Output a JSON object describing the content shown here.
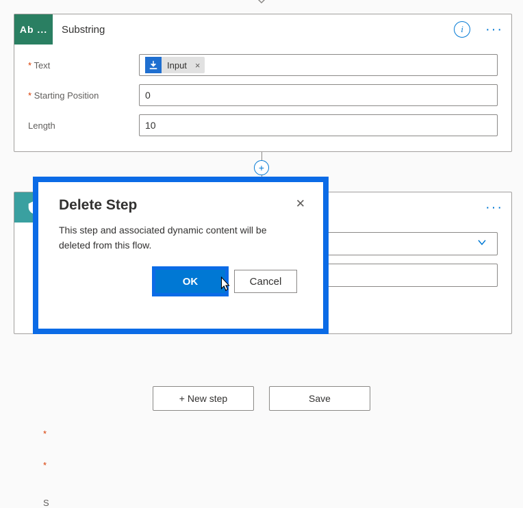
{
  "step1": {
    "iconLabel": "Ab ...",
    "title": "Substring",
    "fields": {
      "textLabel": "Text",
      "textToken": "Input",
      "startLabel": "Starting Position",
      "startValue": "0",
      "lengthLabel": "Length",
      "lengthValue": "10"
    }
  },
  "step2": {
    "label2Stub": "S"
  },
  "dialog": {
    "title": "Delete Step",
    "body": "This step and associated dynamic content will be deleted from this flow.",
    "okLabel": "OK",
    "cancelLabel": "Cancel"
  },
  "footer": {
    "newStepLabel": "+ New step",
    "saveLabel": "Save"
  }
}
